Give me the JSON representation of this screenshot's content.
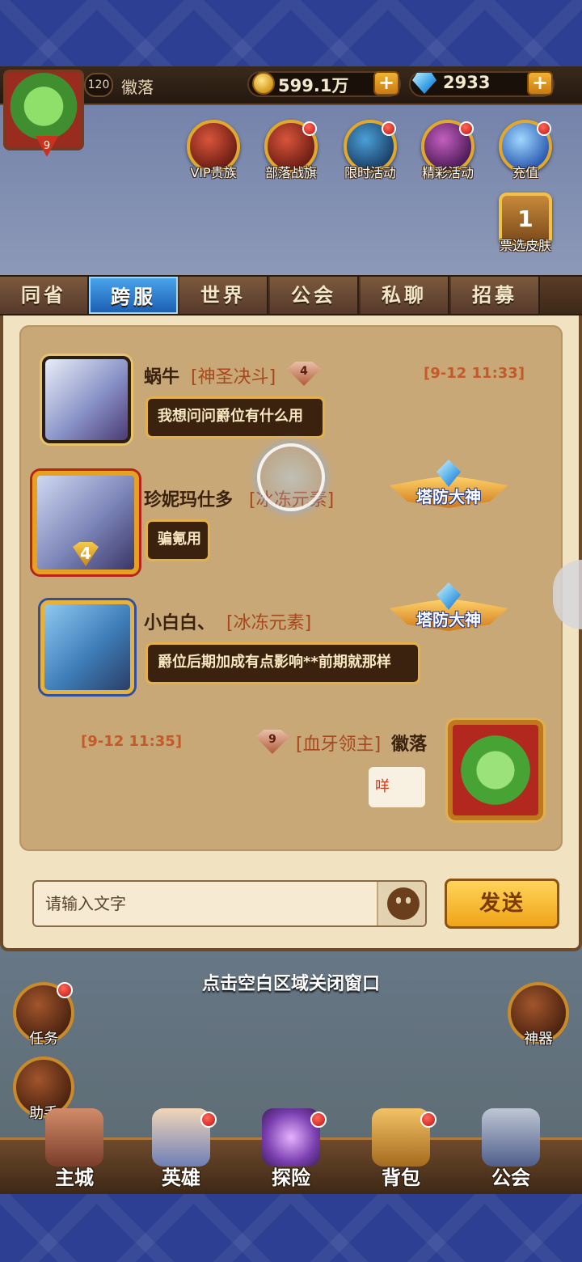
{
  "player": {
    "level": "120",
    "name": "徽落",
    "avatar_level": "9",
    "gold": "599.1万",
    "gems": "2933",
    "add_label": "+"
  },
  "events": [
    {
      "label": "VIP贵族",
      "icon": "crown-icon"
    },
    {
      "label": "部落战旗",
      "icon": "war-banner-icon"
    },
    {
      "label": "限时活动",
      "icon": "clock-icon"
    },
    {
      "label": "精彩活动",
      "icon": "scroll-icon"
    },
    {
      "label": "充值",
      "icon": "gem-icon"
    }
  ],
  "skin_vote": {
    "label": "票选皮肤",
    "number": "1"
  },
  "tabs": [
    {
      "label": "同省"
    },
    {
      "label": "跨服",
      "active": true
    },
    {
      "label": "世界"
    },
    {
      "label": "公会"
    },
    {
      "label": "私聊"
    },
    {
      "label": "招募"
    }
  ],
  "messages": [
    {
      "name": "蜗牛",
      "guild": "[神圣决斗]",
      "rank": "4",
      "time": "[9-12 11:33]",
      "text": "我想问问爵位有什么用"
    },
    {
      "name": "珍妮玛仕多",
      "guild": "[冰冻元素]",
      "avatar_level": "4",
      "badge": "塔防大神",
      "text": "骗氪用"
    },
    {
      "name": "小白白、",
      "guild": "[冰冻元素]",
      "badge": "塔防大神",
      "text": "爵位后期加成有点影响**前期就那样"
    },
    {
      "name": "徽落",
      "guild": "[血牙领主]",
      "rank": "9",
      "time": "[9-12 11:35]",
      "text": "咩"
    }
  ],
  "input": {
    "placeholder": "请输入文字",
    "send_label": "发送"
  },
  "close_hint": "点击空白区域关闭窗口",
  "side_left": [
    {
      "label": "任务"
    },
    {
      "label": "助手"
    }
  ],
  "side_right": [
    {
      "label": "神器"
    }
  ],
  "nav": [
    {
      "label": "主城"
    },
    {
      "label": "英雄"
    },
    {
      "label": "探险"
    },
    {
      "label": "背包"
    },
    {
      "label": "公会"
    }
  ],
  "colors": {
    "tab_active": "#1c5fb3",
    "panel_bg": "#c9a878",
    "guild_text": "#a6471e",
    "timestamp": "#c35a2a",
    "send_button": "#f0a418"
  }
}
